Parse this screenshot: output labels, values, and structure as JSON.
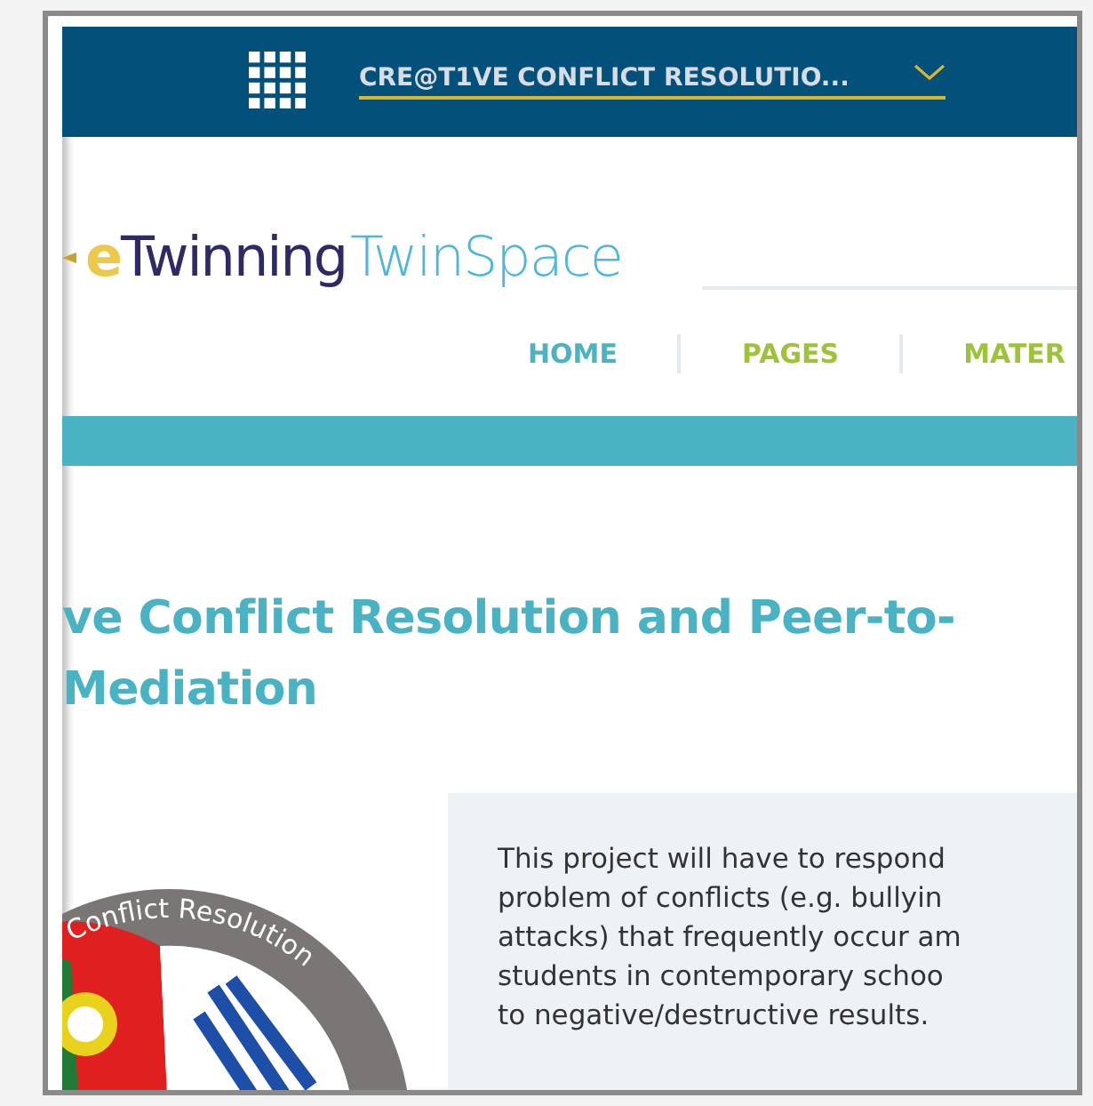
{
  "top_bar": {
    "project_title": "CRE@T1VE CONFLICT RESOLUTIO..."
  },
  "logo": {
    "brand": "eTwinning",
    "product": "TwinSpace"
  },
  "nav": [
    {
      "label": "HOME",
      "color": "#4db3c3"
    },
    {
      "label": "PAGES",
      "color": "#9dc33b"
    },
    {
      "label": "MATER",
      "color": "#9dc33b"
    }
  ],
  "heading": [
    "ve Conflict Resolution and Peer-to-",
    "Mediation"
  ],
  "badge": {
    "arc_text": "Conflict Resolution"
  },
  "description": [
    "This project will have to respond",
    "problem of conflicts (e.g. bullyin",
    "attacks) that frequently occur am",
    "students in contemporary schoo",
    "to negative/destructive results."
  ]
}
